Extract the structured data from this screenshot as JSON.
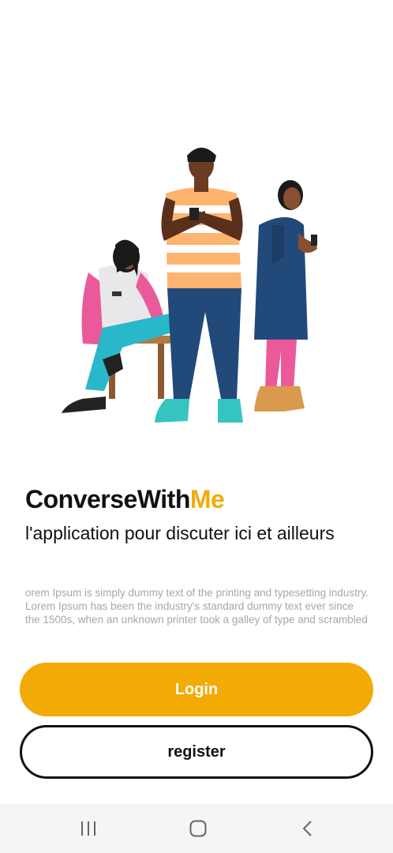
{
  "app": {
    "title_main": "ConverseWith",
    "title_accent": "Me",
    "tagline": "l'application pour discuter ici et ailleurs",
    "description": "orem Ipsum is simply dummy text of the printing and typesetting industry. Lorem Ipsum has been the industry's standard dummy text ever since the 1500s, when an unknown printer took a galley of type and scrambled"
  },
  "buttons": {
    "login_label": "Login",
    "register_label": "register"
  },
  "navbar": {
    "recent_icon": "recent-apps-icon",
    "home_icon": "home-icon",
    "back_icon": "back-icon"
  },
  "colors": {
    "accent": "#F2AA05",
    "text": "#111111",
    "muted": "#a7a7a7"
  }
}
